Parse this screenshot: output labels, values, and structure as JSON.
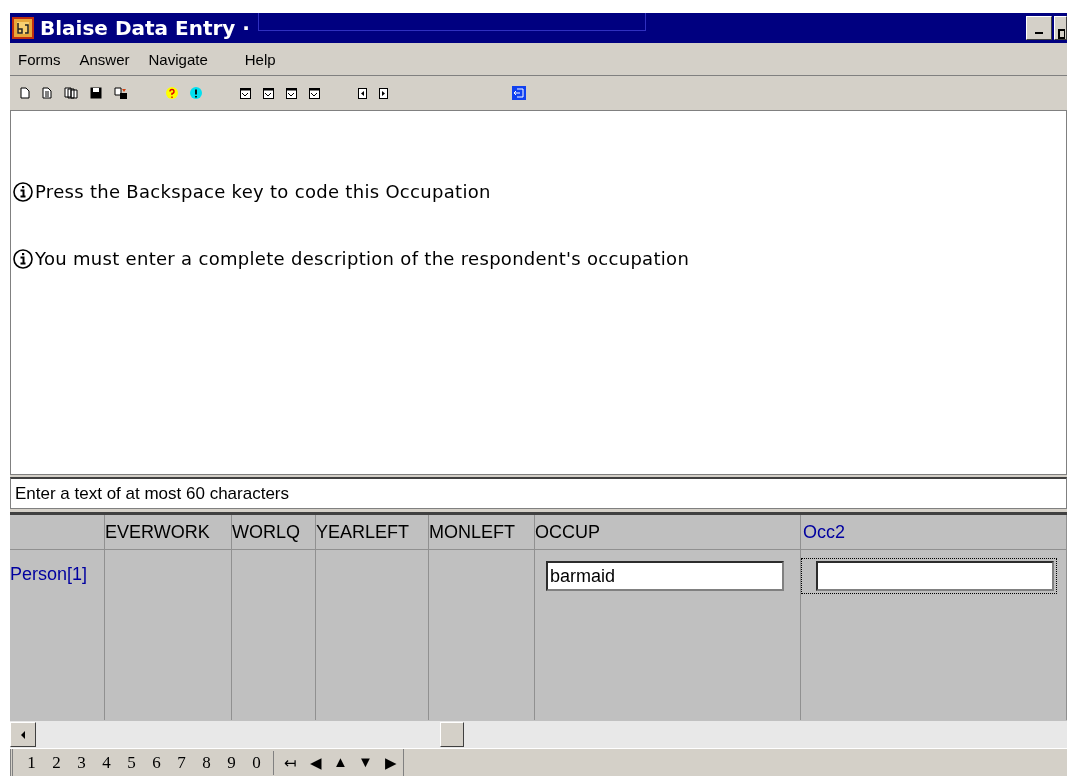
{
  "window": {
    "title": "Blaise Data Entry ·"
  },
  "menu": [
    "Forms",
    "Answer",
    "Navigate",
    "Help"
  ],
  "question": {
    "messages": [
      "Press the Backspace key to code this Occupation",
      "You must enter a complete description of the respondent's occupation"
    ]
  },
  "hint": "Enter a text of at most 60 characters",
  "grid": {
    "columns": [
      {
        "label": "EVERWORK",
        "kind": "plain",
        "current": false
      },
      {
        "label": "WORLQ",
        "kind": "plain",
        "current": false
      },
      {
        "label": "YEARLEFT",
        "kind": "plain",
        "current": false
      },
      {
        "label": "MONLEFT",
        "kind": "plain",
        "current": false
      },
      {
        "label": "OCCUP",
        "kind": "field",
        "current": false
      },
      {
        "label": "Occ2",
        "kind": "field",
        "current": true
      }
    ],
    "rows": [
      {
        "label": "Person[1]",
        "fields": [
          {
            "value": "barmaid",
            "focused": false
          },
          {
            "focused": true
          }
        ]
      }
    ]
  },
  "keypad": {
    "digits": [
      "1",
      "2",
      "3",
      "4",
      "5",
      "6",
      "7",
      "8",
      "9",
      "0"
    ],
    "arrows": [
      "↤",
      "◀",
      "▲",
      "▼",
      "▶"
    ]
  }
}
